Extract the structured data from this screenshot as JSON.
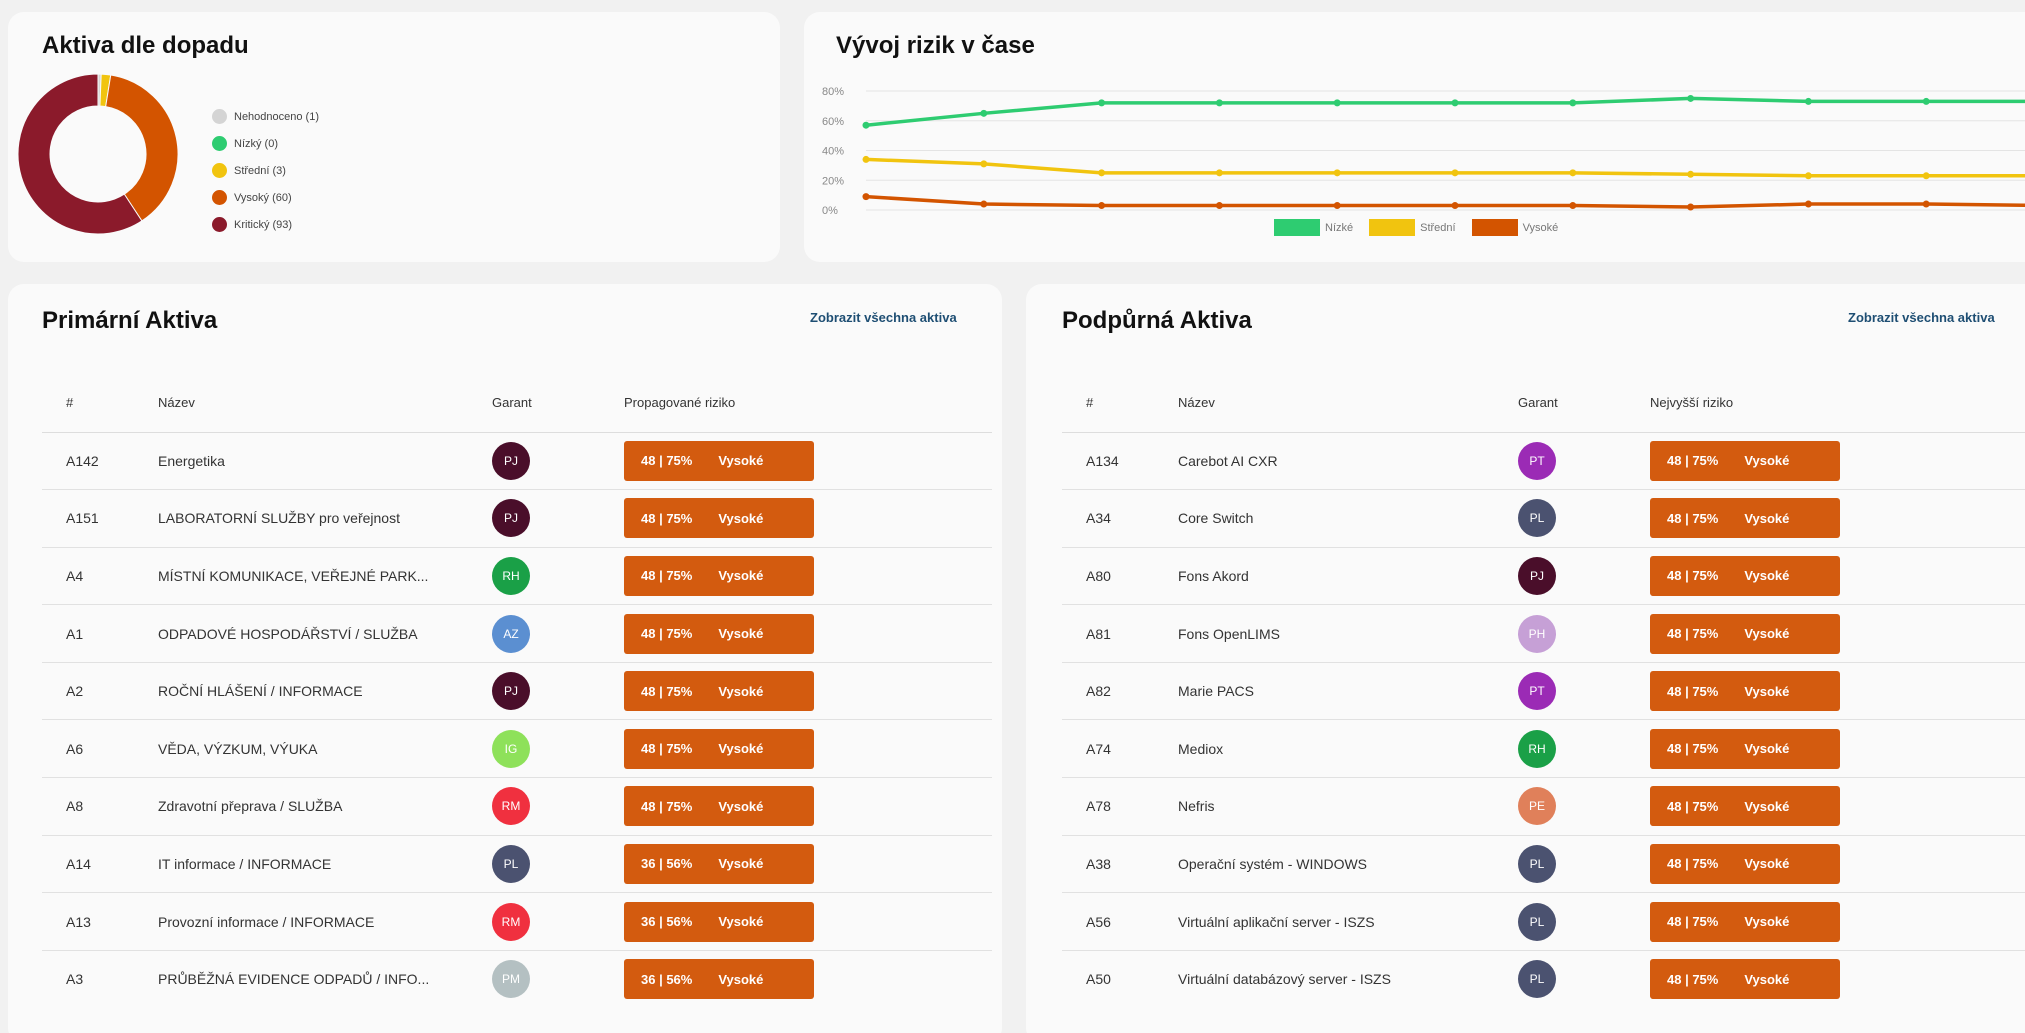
{
  "donut_card": {
    "title": "Aktiva dle dopadu",
    "legend": [
      {
        "label": "Nehodnoceno (1)",
        "value": 1,
        "color": "#d4d4d4"
      },
      {
        "label": "Nízký (0)",
        "value": 0,
        "color": "#2ecc71"
      },
      {
        "label": "Střední (3)",
        "value": 3,
        "color": "#f1c40f"
      },
      {
        "label": "Vysoký (60)",
        "value": 60,
        "color": "#d35400"
      },
      {
        "label": "Kritický (93)",
        "value": 93,
        "color": "#8b1a2b"
      }
    ]
  },
  "trend_card": {
    "title": "Vývoj rizik v čase"
  },
  "chart_data": [
    {
      "type": "pie",
      "categories": [
        "Nehodnoceno",
        "Nízký",
        "Střední",
        "Vysoký",
        "Kritický"
      ],
      "values": [
        1,
        0,
        3,
        60,
        93
      ],
      "title": "Aktiva dle dopadu",
      "legend_position": "right"
    },
    {
      "type": "line",
      "title": "Vývoj rizik v čase",
      "x": [
        1,
        2,
        3,
        4,
        5,
        6,
        7,
        8,
        9,
        10,
        11
      ],
      "ylim": [
        0,
        80
      ],
      "yticks": [
        "0%",
        "20%",
        "40%",
        "60%",
        "80%"
      ],
      "grid": true,
      "legend_position": "bottom",
      "series": [
        {
          "name": "Nízké",
          "color": "#2ecc71",
          "values": [
            57,
            65,
            72,
            72,
            72,
            72,
            72,
            75,
            73,
            73,
            73
          ]
        },
        {
          "name": "Střední",
          "color": "#f1c40f",
          "values": [
            34,
            31,
            25,
            25,
            25,
            25,
            25,
            24,
            23,
            23,
            23
          ]
        },
        {
          "name": "Vysoké",
          "color": "#d35400",
          "values": [
            9,
            4,
            3,
            3,
            3,
            3,
            3,
            2,
            4,
            4,
            3
          ]
        }
      ]
    }
  ],
  "primary": {
    "title": "Primární Aktiva",
    "view_all": "Zobrazit všechna aktiva",
    "headers": [
      "#",
      "Název",
      "Garant",
      "Propagované riziko"
    ],
    "rows": [
      {
        "id": "A142",
        "name": "Energetika",
        "initials": "PJ",
        "color": "#4a0e2a",
        "risk": "48 | 75%",
        "level": "Vysoké"
      },
      {
        "id": "A151",
        "name": "LABORATORNÍ SLUŽBY pro veřejnost",
        "initials": "PJ",
        "color": "#4a0e2a",
        "risk": "48 | 75%",
        "level": "Vysoké"
      },
      {
        "id": "A4",
        "name": "MÍSTNÍ KOMUNIKACE, VEŘEJNÉ PARK...",
        "initials": "RH",
        "color": "#1aa047",
        "risk": "48 | 75%",
        "level": "Vysoké"
      },
      {
        "id": "A1",
        "name": "ODPADOVÉ HOSPODÁŘSTVÍ / SLUŽBA",
        "initials": "AZ",
        "color": "#5b8fd1",
        "risk": "48 | 75%",
        "level": "Vysoké"
      },
      {
        "id": "A2",
        "name": "ROČNÍ HLÁŠENÍ / INFORMACE",
        "initials": "PJ",
        "color": "#4a0e2a",
        "risk": "48 | 75%",
        "level": "Vysoké"
      },
      {
        "id": "A6",
        "name": "VĚDA, VÝZKUM, VÝUKA",
        "initials": "IG",
        "color": "#8ee15a",
        "risk": "48 | 75%",
        "level": "Vysoké"
      },
      {
        "id": "A8",
        "name": "Zdravotní přeprava / SLUŽBA",
        "initials": "RM",
        "color": "#f0303f",
        "risk": "48 | 75%",
        "level": "Vysoké"
      },
      {
        "id": "A14",
        "name": "IT informace / INFORMACE",
        "initials": "PL",
        "color": "#4b5270",
        "risk": "36 | 56%",
        "level": "Vysoké"
      },
      {
        "id": "A13",
        "name": "Provozní informace / INFORMACE",
        "initials": "RM",
        "color": "#f0303f",
        "risk": "36 | 56%",
        "level": "Vysoké"
      },
      {
        "id": "A3",
        "name": "PRŮBĚŽNÁ EVIDENCE ODPADŮ / INFO...",
        "initials": "PM",
        "color": "#b4c0c2",
        "risk": "36 | 56%",
        "level": "Vysoké"
      }
    ]
  },
  "support": {
    "title": "Podpůrná Aktiva",
    "view_all": "Zobrazit všechna aktiva",
    "headers": [
      "#",
      "Název",
      "Garant",
      "Nejvyšší riziko"
    ],
    "rows": [
      {
        "id": "A134",
        "name": "Carebot AI CXR",
        "initials": "PT",
        "color": "#9b2bb5",
        "risk": "48 | 75%",
        "level": "Vysoké"
      },
      {
        "id": "A34",
        "name": "Core Switch",
        "initials": "PL",
        "color": "#4b5270",
        "risk": "48 | 75%",
        "level": "Vysoké"
      },
      {
        "id": "A80",
        "name": "Fons Akord",
        "initials": "PJ",
        "color": "#4a0e2a",
        "risk": "48 | 75%",
        "level": "Vysoké"
      },
      {
        "id": "A81",
        "name": "Fons OpenLIMS",
        "initials": "PH",
        "color": "#c6a0d6",
        "risk": "48 | 75%",
        "level": "Vysoké"
      },
      {
        "id": "A82",
        "name": "Marie PACS",
        "initials": "PT",
        "color": "#9b2bb5",
        "risk": "48 | 75%",
        "level": "Vysoké"
      },
      {
        "id": "A74",
        "name": "Mediox",
        "initials": "RH",
        "color": "#1aa047",
        "risk": "48 | 75%",
        "level": "Vysoké"
      },
      {
        "id": "A78",
        "name": "Nefris",
        "initials": "PE",
        "color": "#e0805a",
        "risk": "48 | 75%",
        "level": "Vysoké"
      },
      {
        "id": "A38",
        "name": "Operační systém - WINDOWS",
        "initials": "PL",
        "color": "#4b5270",
        "risk": "48 | 75%",
        "level": "Vysoké"
      },
      {
        "id": "A56",
        "name": "Virtuální aplikační server - ISZS",
        "initials": "PL",
        "color": "#4b5270",
        "risk": "48 | 75%",
        "level": "Vysoké"
      },
      {
        "id": "A50",
        "name": "Virtuální databázový server - ISZS",
        "initials": "PL",
        "color": "#4b5270",
        "risk": "48 | 75%",
        "level": "Vysoké"
      }
    ]
  }
}
